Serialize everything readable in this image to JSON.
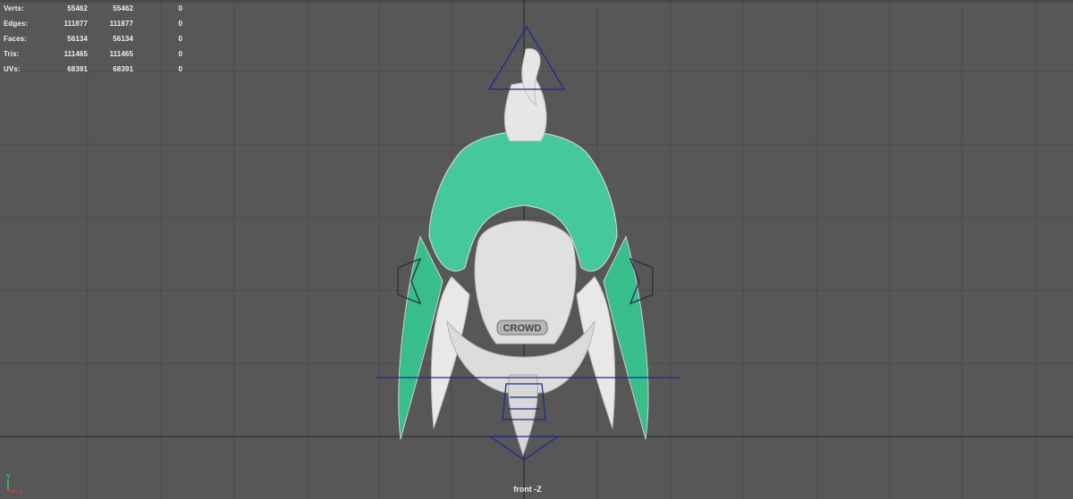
{
  "hud": {
    "rows": [
      {
        "label": "Verts:",
        "v1": "55462",
        "v2": "55462",
        "v3": "0"
      },
      {
        "label": "Edges:",
        "v1": "111877",
        "v2": "111877",
        "v3": "0"
      },
      {
        "label": "Faces:",
        "v1": "56134",
        "v2": "56134",
        "v3": "0"
      },
      {
        "label": "Tris:",
        "v1": "111465",
        "v2": "111465",
        "v3": "0"
      },
      {
        "label": "UVs:",
        "v1": "68391",
        "v2": "68391",
        "v3": "0"
      }
    ]
  },
  "viewport": {
    "camera_label": "front -Z",
    "plate_text": "CROWD",
    "axis_labels": {
      "y": "Y",
      "x": "X"
    }
  },
  "colors": {
    "background": "#575757",
    "grid": "#4b4b4b",
    "skin": "#3ec995",
    "mesh": "#e6e6e6",
    "controls": "#1d2b8a"
  }
}
